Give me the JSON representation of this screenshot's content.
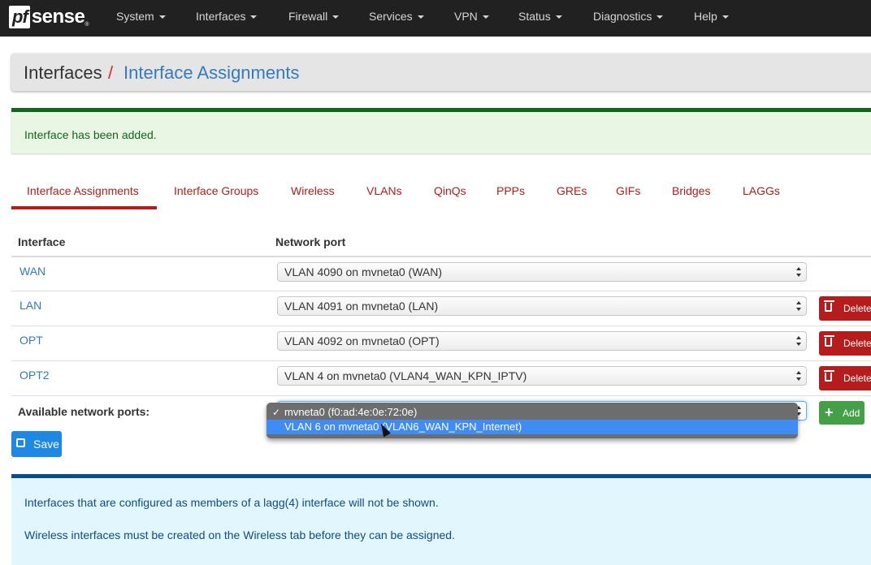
{
  "brand": {
    "logo_left": "pf",
    "logo_right": "sense",
    "tm": "®"
  },
  "nav": [
    "System",
    "Interfaces",
    "Firewall",
    "Services",
    "VPN",
    "Status",
    "Diagnostics",
    "Help"
  ],
  "breadcrumb": {
    "parent": "Interfaces",
    "separator": "/",
    "current": "Interface Assignments"
  },
  "alert_success": "Interface has been added.",
  "tabs": [
    "Interface Assignments",
    "Interface Groups",
    "Wireless",
    "VLANs",
    "QinQs",
    "PPPs",
    "GREs",
    "GIFs",
    "Bridges",
    "LAGGs"
  ],
  "active_tab": "Interface Assignments",
  "table": {
    "headers": {
      "interface": "Interface",
      "network_port": "Network port"
    },
    "rows": [
      {
        "interface": "WAN",
        "port": "VLAN 4090 on mvneta0 (WAN)",
        "action": ""
      },
      {
        "interface": "LAN",
        "port": "VLAN 4091 on mvneta0 (LAN)",
        "action": "Delete"
      },
      {
        "interface": "OPT",
        "port": "VLAN 4092 on mvneta0 (OPT)",
        "action": "Delete"
      },
      {
        "interface": "OPT2",
        "port": "VLAN 4 on mvneta0 (VLAN4_WAN_KPN_IPTV)",
        "action": "Delete"
      }
    ],
    "available_label": "Available network ports:",
    "add_label": "Add"
  },
  "dropdown": {
    "options": [
      {
        "label": "mvneta0 (f0:ad:4e:0e:72:0e)",
        "checked": "✓"
      },
      {
        "label": "VLAN 6 on mvneta0 (VLAN6_WAN_KPN_Internet)",
        "checked": ""
      }
    ],
    "highlight_color": "#3f8df4"
  },
  "save_label": "Save",
  "info": [
    "Interfaces that are configured as members of a lagg(4) interface will not be shown.",
    "Wireless interfaces must be created on the Wireless tab before they can be assigned."
  ],
  "colors": {
    "navbar": "#212121",
    "link": "#317cbf",
    "tab_active": "#b71c1c",
    "danger": "#b71c1c",
    "success": "#43a047",
    "primary": "#1e88e5"
  }
}
